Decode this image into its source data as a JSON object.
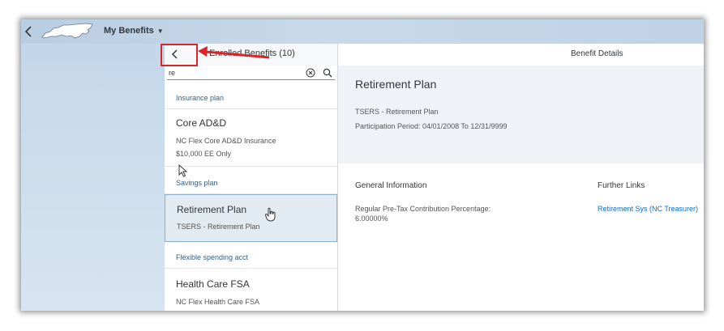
{
  "shell": {
    "app_title": "My Benefits"
  },
  "master": {
    "title": "Enrolled Benefits (10)",
    "search": {
      "value": "re",
      "placeholder": ""
    },
    "groups": [
      {
        "header": "Insurance plan",
        "items": [
          {
            "title": "Core AD&D",
            "lines": [
              "NC Flex Core AD&D Insurance",
              "$10,000 EE Only"
            ]
          }
        ]
      },
      {
        "header": "Savings plan",
        "items": [
          {
            "title": "Retirement Plan",
            "lines": [
              "TSERS - Retirement Plan"
            ],
            "selected": true
          }
        ]
      },
      {
        "header": "Flexible spending acct",
        "items": [
          {
            "title": "Health Care FSA",
            "lines": [
              "NC Flex Health Care FSA"
            ]
          }
        ]
      }
    ]
  },
  "detail": {
    "topbar_title": "Benefit Details",
    "title": "Retirement Plan",
    "subtitle": "TSERS - Retirement Plan",
    "participation_period": "Participation Period: 04/01/2008 To 12/31/9999",
    "general_information": {
      "title": "General Information",
      "label": "Regular Pre-Tax Contribution Percentage:",
      "value": "6.00000%"
    },
    "further_links": {
      "title": "Further Links",
      "link": "Retirement Sys (NC Treasurer)"
    }
  },
  "colors": {
    "accent": "#0a6ed1",
    "group_header": "#346187",
    "selected_bg": "#e2eaf2",
    "annotation": "#d9252a"
  }
}
